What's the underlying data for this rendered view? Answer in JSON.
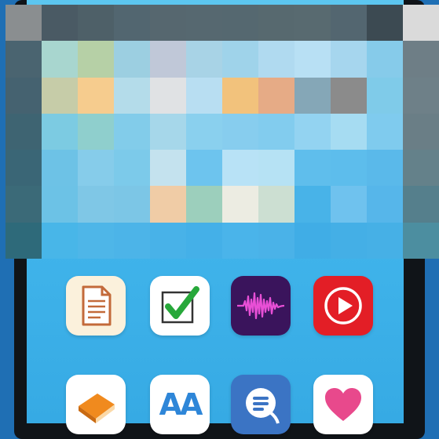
{
  "colors": {
    "background": "#1f6fb4",
    "screen": "#45b6ec",
    "phone_frame": "#101418"
  },
  "pixelated_region": {
    "rows": [
      [
        "#8a8e90",
        "#4a5a64",
        "#4e6068",
        "#526670",
        "#56676f",
        "#566870",
        "#556870",
        "#57696f",
        "#586a70",
        "#536670",
        "#3c4a52",
        "#dadada"
      ],
      [
        "#4a6470",
        "#a8d6cf",
        "#b6d0a6",
        "#9ccfe1",
        "#c0c8d8",
        "#a8d3e6",
        "#9fd3ea",
        "#b0daf0",
        "#b8e0f4",
        "#a6d6ee",
        "#86cbea",
        "#6e7e86"
      ],
      [
        "#456270",
        "#c6cca8",
        "#f6cc8e",
        "#b4dcea",
        "#e0e2e4",
        "#b8def2",
        "#f2c27c",
        "#e6ab86",
        "#85a7b7",
        "#8b8b8b",
        "#7fcbe9",
        "#6e8088"
      ],
      [
        "#3e6472",
        "#7ccbe2",
        "#8fcfcd",
        "#82ccea",
        "#a6d7ea",
        "#8ad0ee",
        "#87cdee",
        "#82ccee",
        "#93d3f1",
        "#a6dcf2",
        "#7fcbee",
        "#6a7e86"
      ],
      [
        "#3a6676",
        "#6dc2e6",
        "#86ccea",
        "#7ccaea",
        "#c4e2ee",
        "#6dc4ee",
        "#b8e2f6",
        "#b6e2f4",
        "#5fbeec",
        "#5dbdec",
        "#5ab9ea",
        "#64818a"
      ],
      [
        "#3b6a78",
        "#6cc2e6",
        "#7fc7e6",
        "#7cc6e6",
        "#f0cca6",
        "#9ccfbc",
        "#ecece2",
        "#ccdfd2",
        "#48b3e8",
        "#6fc2ee",
        "#56b6ea",
        "#557f8c"
      ],
      [
        "#2e6a7a",
        "#48b6e8",
        "#4eb6e8",
        "#4cb4e8",
        "#48b2e8",
        "#44b0e8",
        "#4ab4ea",
        "#4ab2e8",
        "#40ade6",
        "#44afe6",
        "#46b0e6",
        "#4c8ea0"
      ]
    ]
  },
  "apps": [
    {
      "name": "document-app-icon",
      "bg": "#fbf1dc",
      "accent": "#c36a3a"
    },
    {
      "name": "checklist-app-icon",
      "bg": "#ffffff",
      "accent": "#27a83a"
    },
    {
      "name": "voice-memos-app-icon",
      "bg": "#3a145c",
      "accent": "#e84fd6"
    },
    {
      "name": "video-player-app-icon",
      "bg": "#e31e26",
      "accent": "#ffffff"
    },
    {
      "name": "books-app-icon",
      "bg": "#ffffff",
      "accent": "#f08a1e"
    },
    {
      "name": "dictionary-app-icon",
      "bg": "#ffffff",
      "accent": "#2e86d8",
      "label": "AA"
    },
    {
      "name": "messaging-app-icon",
      "bg": "#3b74c4",
      "accent": "#ffffff"
    },
    {
      "name": "health-app-icon",
      "bg": "#ffffff",
      "accent": "#e8498c"
    }
  ]
}
